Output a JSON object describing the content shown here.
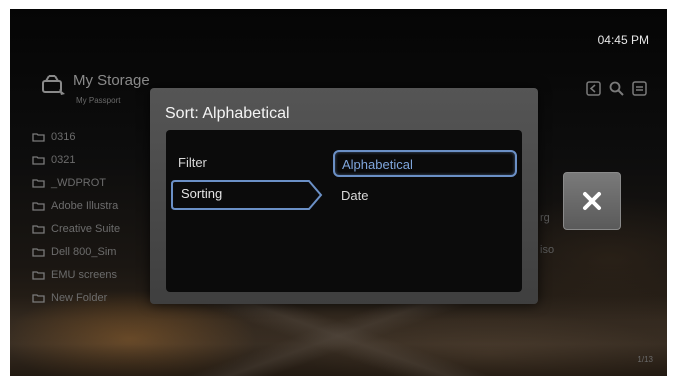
{
  "header": {
    "clock": "04:45 PM"
  },
  "storage": {
    "title": "My Storage",
    "subtitle": "My Passport"
  },
  "toolbar": {
    "icons": [
      "back-icon",
      "search-icon",
      "menu-icon"
    ]
  },
  "file_list": [
    "0316",
    "0321",
    "_WDPROT",
    "Adobe Illustra",
    "Creative Suite",
    "Dell 800_Sim",
    "EMU screens",
    "New Folder"
  ],
  "background_fragments": {
    "row4_suffix": "rg",
    "row5_suffix": "iso"
  },
  "pagination": "1/13",
  "dialog": {
    "title": "Sort: Alphabetical",
    "menu": {
      "filter": "Filter",
      "sorting": "Sorting"
    },
    "options": {
      "alphabetical": "Alphabetical",
      "date": "Date"
    },
    "selected_option": "Alphabetical",
    "accent": "#6b90c6"
  }
}
